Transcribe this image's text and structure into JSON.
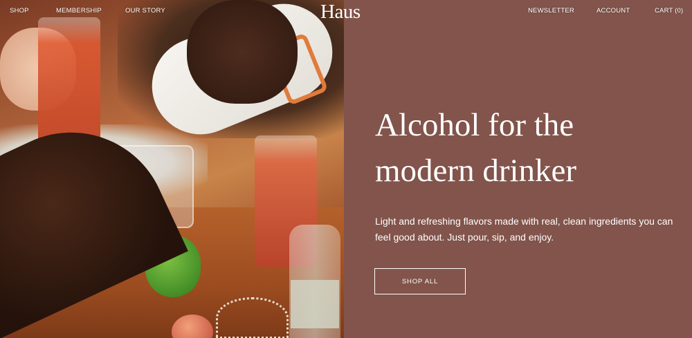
{
  "brand": {
    "logo_text": "Haus"
  },
  "nav": {
    "left": [
      {
        "label": "SHOP"
      },
      {
        "label": "MEMBERSHIP"
      },
      {
        "label": "OUR STORY"
      }
    ],
    "right": [
      {
        "label": "NEWSLETTER"
      },
      {
        "label": "ACCOUNT"
      },
      {
        "label": "CART (0)"
      }
    ]
  },
  "hero": {
    "title": "Alcohol for the modern drinker",
    "subtitle": "Light and refreshing flavors made with real, clean ingredients you can feel good about. Just pour, sip, and enjoy.",
    "cta_label": "SHOP ALL"
  },
  "colors": {
    "panel_bg": "#82544b",
    "text": "#ffffff"
  }
}
